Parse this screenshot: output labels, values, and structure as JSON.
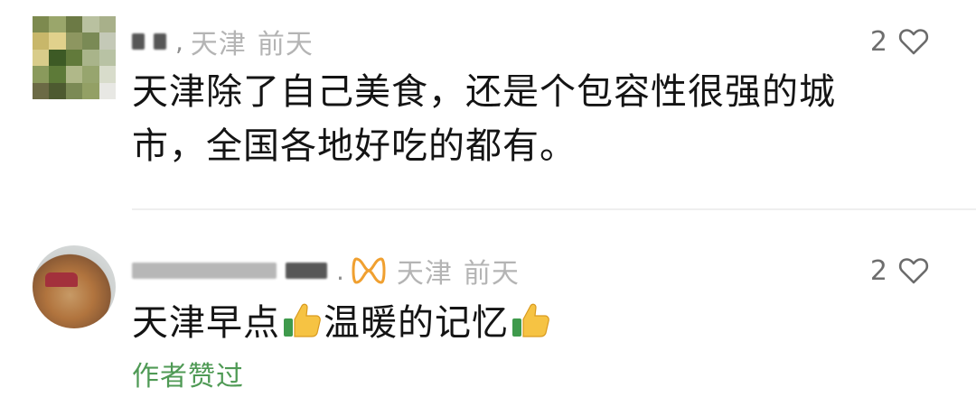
{
  "comments": [
    {
      "nickname_masked": true,
      "region": "天津",
      "time": "前天",
      "likes": "2",
      "text": "天津除了自己美食，还是个包容性很强的城市，全国各地好吃的都有。"
    },
    {
      "nickname_masked": true,
      "badge_icon": "fan-badge-icon",
      "region": "天津",
      "time": "前天",
      "likes": "2",
      "text_parts": [
        "天津早点",
        "温暖的记忆"
      ],
      "emoji": "thumbs-up-icon",
      "author_liked": "作者赞过"
    }
  ],
  "colors": {
    "meta_gray": "#b4b4b4",
    "author_liked_green": "#4f9a55",
    "badge_orange": "#f0a030",
    "text": "#141414"
  }
}
